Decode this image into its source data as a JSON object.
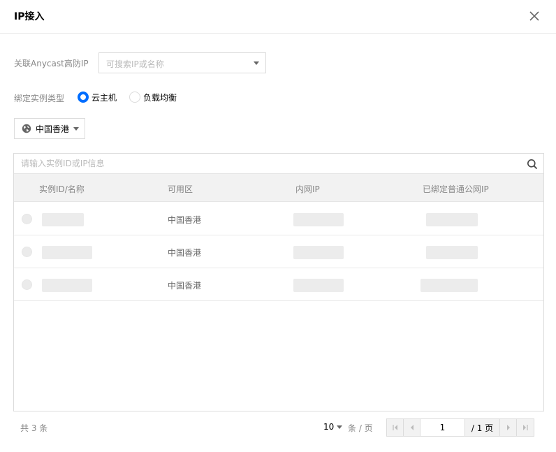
{
  "dialog": {
    "title": "IP接入",
    "close_icon": "close-icon"
  },
  "anycast": {
    "label": "关联Anycast高防IP",
    "placeholder": "可搜索IP或名称"
  },
  "instance_type": {
    "label": "绑定实例类型",
    "options": [
      {
        "label": "云主机",
        "selected": true
      },
      {
        "label": "负载均衡",
        "selected": false
      }
    ]
  },
  "region": {
    "label": "中国香港",
    "icon": "globe-icon"
  },
  "search": {
    "placeholder": "请输入实例ID或IP信息",
    "icon": "search-icon"
  },
  "table": {
    "columns": [
      "实例ID/名称",
      "可用区",
      "内网IP",
      "已绑定普通公网IP"
    ],
    "rows": [
      {
        "zone": "中国香港"
      },
      {
        "zone": "中国香港"
      },
      {
        "zone": "中国香港"
      }
    ]
  },
  "footer": {
    "total": "共 3 条",
    "page_size": "10",
    "per_page_label": "条 / 页",
    "current_page": "1",
    "total_pages": "/ 1 页"
  },
  "colors": {
    "accent": "#006eff",
    "border": "#dcdcdc",
    "header_bg": "#f2f2f2"
  }
}
